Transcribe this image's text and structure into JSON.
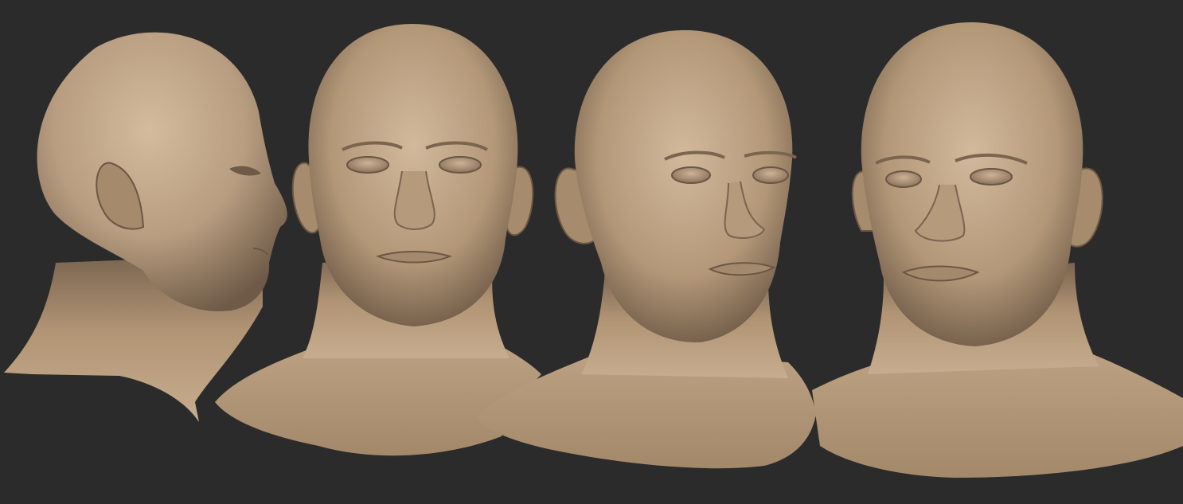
{
  "scene": {
    "background_color": "#2b2b2b",
    "material_color": "#b89d80",
    "views": [
      {
        "name": "profile-right",
        "icon": "sculpt-head-icon"
      },
      {
        "name": "front",
        "icon": "sculpt-head-icon"
      },
      {
        "name": "three-quarter-left",
        "icon": "sculpt-head-icon"
      },
      {
        "name": "three-quarter-right",
        "icon": "sculpt-head-icon"
      }
    ]
  }
}
